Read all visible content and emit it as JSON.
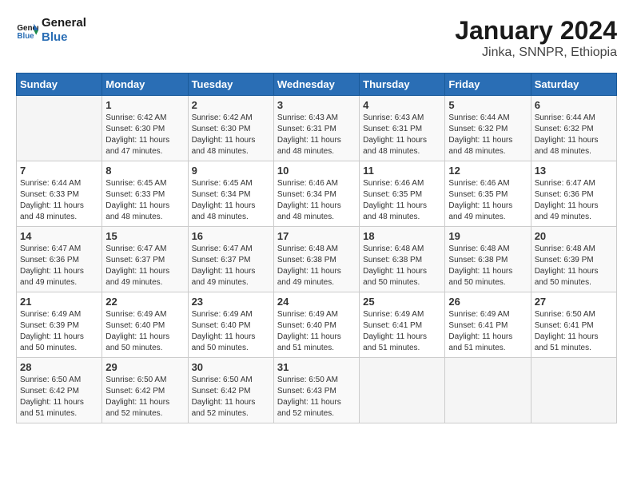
{
  "header": {
    "logo_line1": "General",
    "logo_line2": "Blue",
    "title": "January 2024",
    "subtitle": "Jinka, SNNPR, Ethiopia"
  },
  "days_of_week": [
    "Sunday",
    "Monday",
    "Tuesday",
    "Wednesday",
    "Thursday",
    "Friday",
    "Saturday"
  ],
  "weeks": [
    [
      {
        "day": "",
        "info": ""
      },
      {
        "day": "1",
        "info": "Sunrise: 6:42 AM\nSunset: 6:30 PM\nDaylight: 11 hours\nand 47 minutes."
      },
      {
        "day": "2",
        "info": "Sunrise: 6:42 AM\nSunset: 6:30 PM\nDaylight: 11 hours\nand 48 minutes."
      },
      {
        "day": "3",
        "info": "Sunrise: 6:43 AM\nSunset: 6:31 PM\nDaylight: 11 hours\nand 48 minutes."
      },
      {
        "day": "4",
        "info": "Sunrise: 6:43 AM\nSunset: 6:31 PM\nDaylight: 11 hours\nand 48 minutes."
      },
      {
        "day": "5",
        "info": "Sunrise: 6:44 AM\nSunset: 6:32 PM\nDaylight: 11 hours\nand 48 minutes."
      },
      {
        "day": "6",
        "info": "Sunrise: 6:44 AM\nSunset: 6:32 PM\nDaylight: 11 hours\nand 48 minutes."
      }
    ],
    [
      {
        "day": "7",
        "info": "Sunrise: 6:44 AM\nSunset: 6:33 PM\nDaylight: 11 hours\nand 48 minutes."
      },
      {
        "day": "8",
        "info": "Sunrise: 6:45 AM\nSunset: 6:33 PM\nDaylight: 11 hours\nand 48 minutes."
      },
      {
        "day": "9",
        "info": "Sunrise: 6:45 AM\nSunset: 6:34 PM\nDaylight: 11 hours\nand 48 minutes."
      },
      {
        "day": "10",
        "info": "Sunrise: 6:46 AM\nSunset: 6:34 PM\nDaylight: 11 hours\nand 48 minutes."
      },
      {
        "day": "11",
        "info": "Sunrise: 6:46 AM\nSunset: 6:35 PM\nDaylight: 11 hours\nand 48 minutes."
      },
      {
        "day": "12",
        "info": "Sunrise: 6:46 AM\nSunset: 6:35 PM\nDaylight: 11 hours\nand 49 minutes."
      },
      {
        "day": "13",
        "info": "Sunrise: 6:47 AM\nSunset: 6:36 PM\nDaylight: 11 hours\nand 49 minutes."
      }
    ],
    [
      {
        "day": "14",
        "info": "Sunrise: 6:47 AM\nSunset: 6:36 PM\nDaylight: 11 hours\nand 49 minutes."
      },
      {
        "day": "15",
        "info": "Sunrise: 6:47 AM\nSunset: 6:37 PM\nDaylight: 11 hours\nand 49 minutes."
      },
      {
        "day": "16",
        "info": "Sunrise: 6:47 AM\nSunset: 6:37 PM\nDaylight: 11 hours\nand 49 minutes."
      },
      {
        "day": "17",
        "info": "Sunrise: 6:48 AM\nSunset: 6:38 PM\nDaylight: 11 hours\nand 49 minutes."
      },
      {
        "day": "18",
        "info": "Sunrise: 6:48 AM\nSunset: 6:38 PM\nDaylight: 11 hours\nand 50 minutes."
      },
      {
        "day": "19",
        "info": "Sunrise: 6:48 AM\nSunset: 6:38 PM\nDaylight: 11 hours\nand 50 minutes."
      },
      {
        "day": "20",
        "info": "Sunrise: 6:48 AM\nSunset: 6:39 PM\nDaylight: 11 hours\nand 50 minutes."
      }
    ],
    [
      {
        "day": "21",
        "info": "Sunrise: 6:49 AM\nSunset: 6:39 PM\nDaylight: 11 hours\nand 50 minutes."
      },
      {
        "day": "22",
        "info": "Sunrise: 6:49 AM\nSunset: 6:40 PM\nDaylight: 11 hours\nand 50 minutes."
      },
      {
        "day": "23",
        "info": "Sunrise: 6:49 AM\nSunset: 6:40 PM\nDaylight: 11 hours\nand 50 minutes."
      },
      {
        "day": "24",
        "info": "Sunrise: 6:49 AM\nSunset: 6:40 PM\nDaylight: 11 hours\nand 51 minutes."
      },
      {
        "day": "25",
        "info": "Sunrise: 6:49 AM\nSunset: 6:41 PM\nDaylight: 11 hours\nand 51 minutes."
      },
      {
        "day": "26",
        "info": "Sunrise: 6:49 AM\nSunset: 6:41 PM\nDaylight: 11 hours\nand 51 minutes."
      },
      {
        "day": "27",
        "info": "Sunrise: 6:50 AM\nSunset: 6:41 PM\nDaylight: 11 hours\nand 51 minutes."
      }
    ],
    [
      {
        "day": "28",
        "info": "Sunrise: 6:50 AM\nSunset: 6:42 PM\nDaylight: 11 hours\nand 51 minutes."
      },
      {
        "day": "29",
        "info": "Sunrise: 6:50 AM\nSunset: 6:42 PM\nDaylight: 11 hours\nand 52 minutes."
      },
      {
        "day": "30",
        "info": "Sunrise: 6:50 AM\nSunset: 6:42 PM\nDaylight: 11 hours\nand 52 minutes."
      },
      {
        "day": "31",
        "info": "Sunrise: 6:50 AM\nSunset: 6:43 PM\nDaylight: 11 hours\nand 52 minutes."
      },
      {
        "day": "",
        "info": ""
      },
      {
        "day": "",
        "info": ""
      },
      {
        "day": "",
        "info": ""
      }
    ]
  ]
}
